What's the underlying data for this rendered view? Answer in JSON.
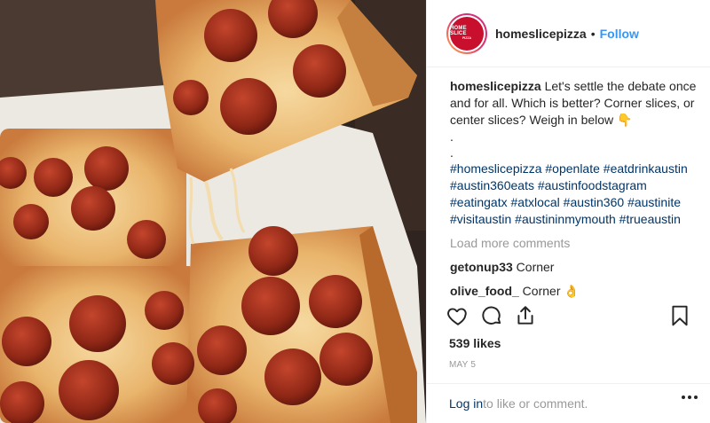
{
  "header": {
    "avatar_line1": "HOME SLICE",
    "avatar_line2": "PIZZA",
    "username": "homeslicepizza",
    "separator": "•",
    "follow_label": "Follow"
  },
  "caption": {
    "username": "homeslicepizza",
    "text": " Let's settle the debate once and for all. Which is better? Corner slices, or center slices? Weigh in below 👇",
    "dot1": ".",
    "dot2": ".",
    "hashtags": [
      "#homeslicepizza",
      "#openlate",
      "#eatdrinkaustin",
      "#austin360eats",
      "#austinfoodstagram",
      "#eatingatx",
      "#atxlocal",
      "#austin360",
      "#austinite",
      "#visitaustin",
      "#austininmymouth",
      "#trueaustin"
    ]
  },
  "load_more_label": "Load more comments",
  "comments": [
    {
      "username": "getonup33",
      "text": " Corner"
    },
    {
      "username": "olive_food_",
      "text": " Corner 👌"
    }
  ],
  "icons": {
    "like": "heart-icon",
    "comment": "comment-bubble-icon",
    "share": "share-icon",
    "save": "bookmark-icon",
    "more": "more-options-icon"
  },
  "likes_label": "539 likes",
  "date_label": "MAY 5",
  "add_comment": {
    "login_label": "Log in",
    "rest_label": " to like or comment."
  },
  "colors": {
    "link_blue": "#3897f0",
    "hashtag_blue": "#003569",
    "muted": "#999999",
    "text": "#262626",
    "brand_red": "#c8102e"
  }
}
